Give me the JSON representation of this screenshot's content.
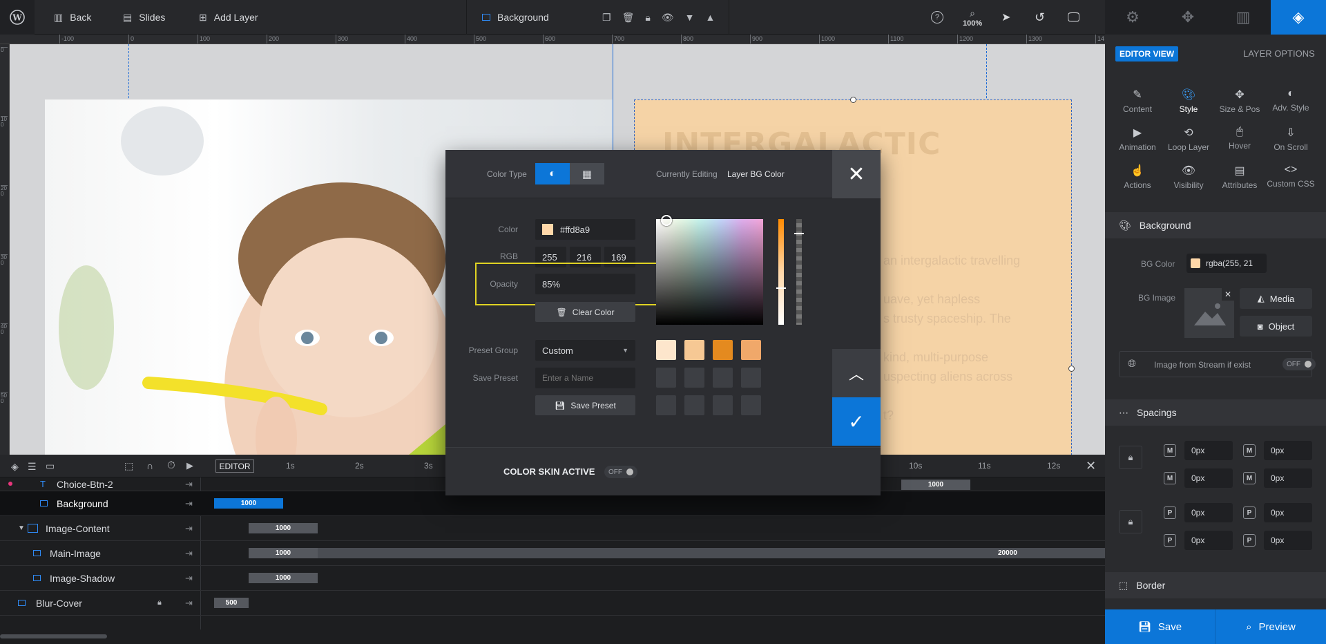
{
  "topbar": {
    "back_label": "Back",
    "slides_label": "Slides",
    "add_layer_label": "Add Layer",
    "current_layer": "Background",
    "zoom": "100%"
  },
  "ruler": {
    "top_ticks": [
      "-100",
      "0",
      "100",
      "200",
      "300",
      "400",
      "500",
      "600",
      "700",
      "800",
      "900",
      "1000",
      "1100",
      "1200",
      "1300",
      "14"
    ],
    "left_ticks": [
      "0",
      "100",
      "200",
      "300",
      "400",
      "500"
    ]
  },
  "canvas": {
    "card_heading": "INTERGALACTIC",
    "card_lines": [
      "an intergalactic travelling",
      "uave, yet hapless",
      "s trusty spaceship. The",
      "kind, multi-purpose",
      "uspecting aliens across",
      "t?"
    ]
  },
  "picker": {
    "color_type_label": "Color Type",
    "currently_editing_label": "Currently Editing",
    "currently_editing_value": "Layer BG Color",
    "color_label": "Color",
    "color_hex": "#ffd8a9",
    "rgb_label": "RGB",
    "rgb": [
      "255",
      "216",
      "169"
    ],
    "opacity_label": "Opacity",
    "opacity_value": "85%",
    "clear_color_label": "Clear Color",
    "preset_group_label": "Preset Group",
    "preset_group_value": "Custom",
    "save_preset_label": "Save Preset",
    "save_preset_placeholder": "Enter a Name",
    "save_preset_button": "Save Preset",
    "swatch_colors": [
      "#fde6cc",
      "#f6c894",
      "#e48a1f",
      "#f0a86a"
    ],
    "color_skin_label": "COLOR SKIN ACTIVE",
    "color_skin_toggle": "OFF",
    "accent_color": "#0c76d8",
    "highlight_color": "#e0d323"
  },
  "timeline": {
    "editor_label": "EDITOR",
    "time_ticks": [
      "1s",
      "2s",
      "3s",
      "10s",
      "11s",
      "12s"
    ],
    "rows": [
      {
        "name": "Choice-Btn-2",
        "bar": "1000"
      },
      {
        "name": "Background",
        "bar": "1000"
      },
      {
        "name": "Image-Content",
        "bar": "1000"
      },
      {
        "name": "Main-Image",
        "bar": "1000",
        "bar2": "20000"
      },
      {
        "name": "Image-Shadow",
        "bar": "1000"
      },
      {
        "name": "Blur-Cover",
        "bar": "500"
      }
    ]
  },
  "sidebar": {
    "editor_view_label": "EDITOR VIEW",
    "layer_options_label": "LAYER OPTIONS",
    "options": [
      {
        "label": "Content",
        "icon": "pencil-icon"
      },
      {
        "label": "Style",
        "icon": "palette-icon"
      },
      {
        "label": "Size & Pos",
        "icon": "move-icon"
      },
      {
        "label": "Adv. Style",
        "icon": "drop-icon"
      },
      {
        "label": "Animation",
        "icon": "play-icon"
      },
      {
        "label": "Loop Layer",
        "icon": "loop-icon"
      },
      {
        "label": "Hover",
        "icon": "mouse-icon"
      },
      {
        "label": "On Scroll",
        "icon": "scroll-icon"
      },
      {
        "label": "Actions",
        "icon": "hand-icon"
      },
      {
        "label": "Visibility",
        "icon": "eye-icon"
      },
      {
        "label": "Attributes",
        "icon": "doc-icon"
      },
      {
        "label": "Custom CSS",
        "icon": "code-icon"
      }
    ],
    "background_section": "Background",
    "bg_color_label": "BG Color",
    "bg_color_value": "rgba(255, 21",
    "bg_image_label": "BG Image",
    "media_label": "Media",
    "object_label": "Object",
    "stream_label": "Image from Stream if exist",
    "stream_toggle": "OFF",
    "spacings_section": "Spacings",
    "spacing_values": [
      "0px",
      "0px",
      "0px",
      "0px",
      "0px",
      "0px",
      "0px",
      "0px"
    ],
    "border_section": "Border",
    "save_label": "Save",
    "preview_label": "Preview"
  }
}
